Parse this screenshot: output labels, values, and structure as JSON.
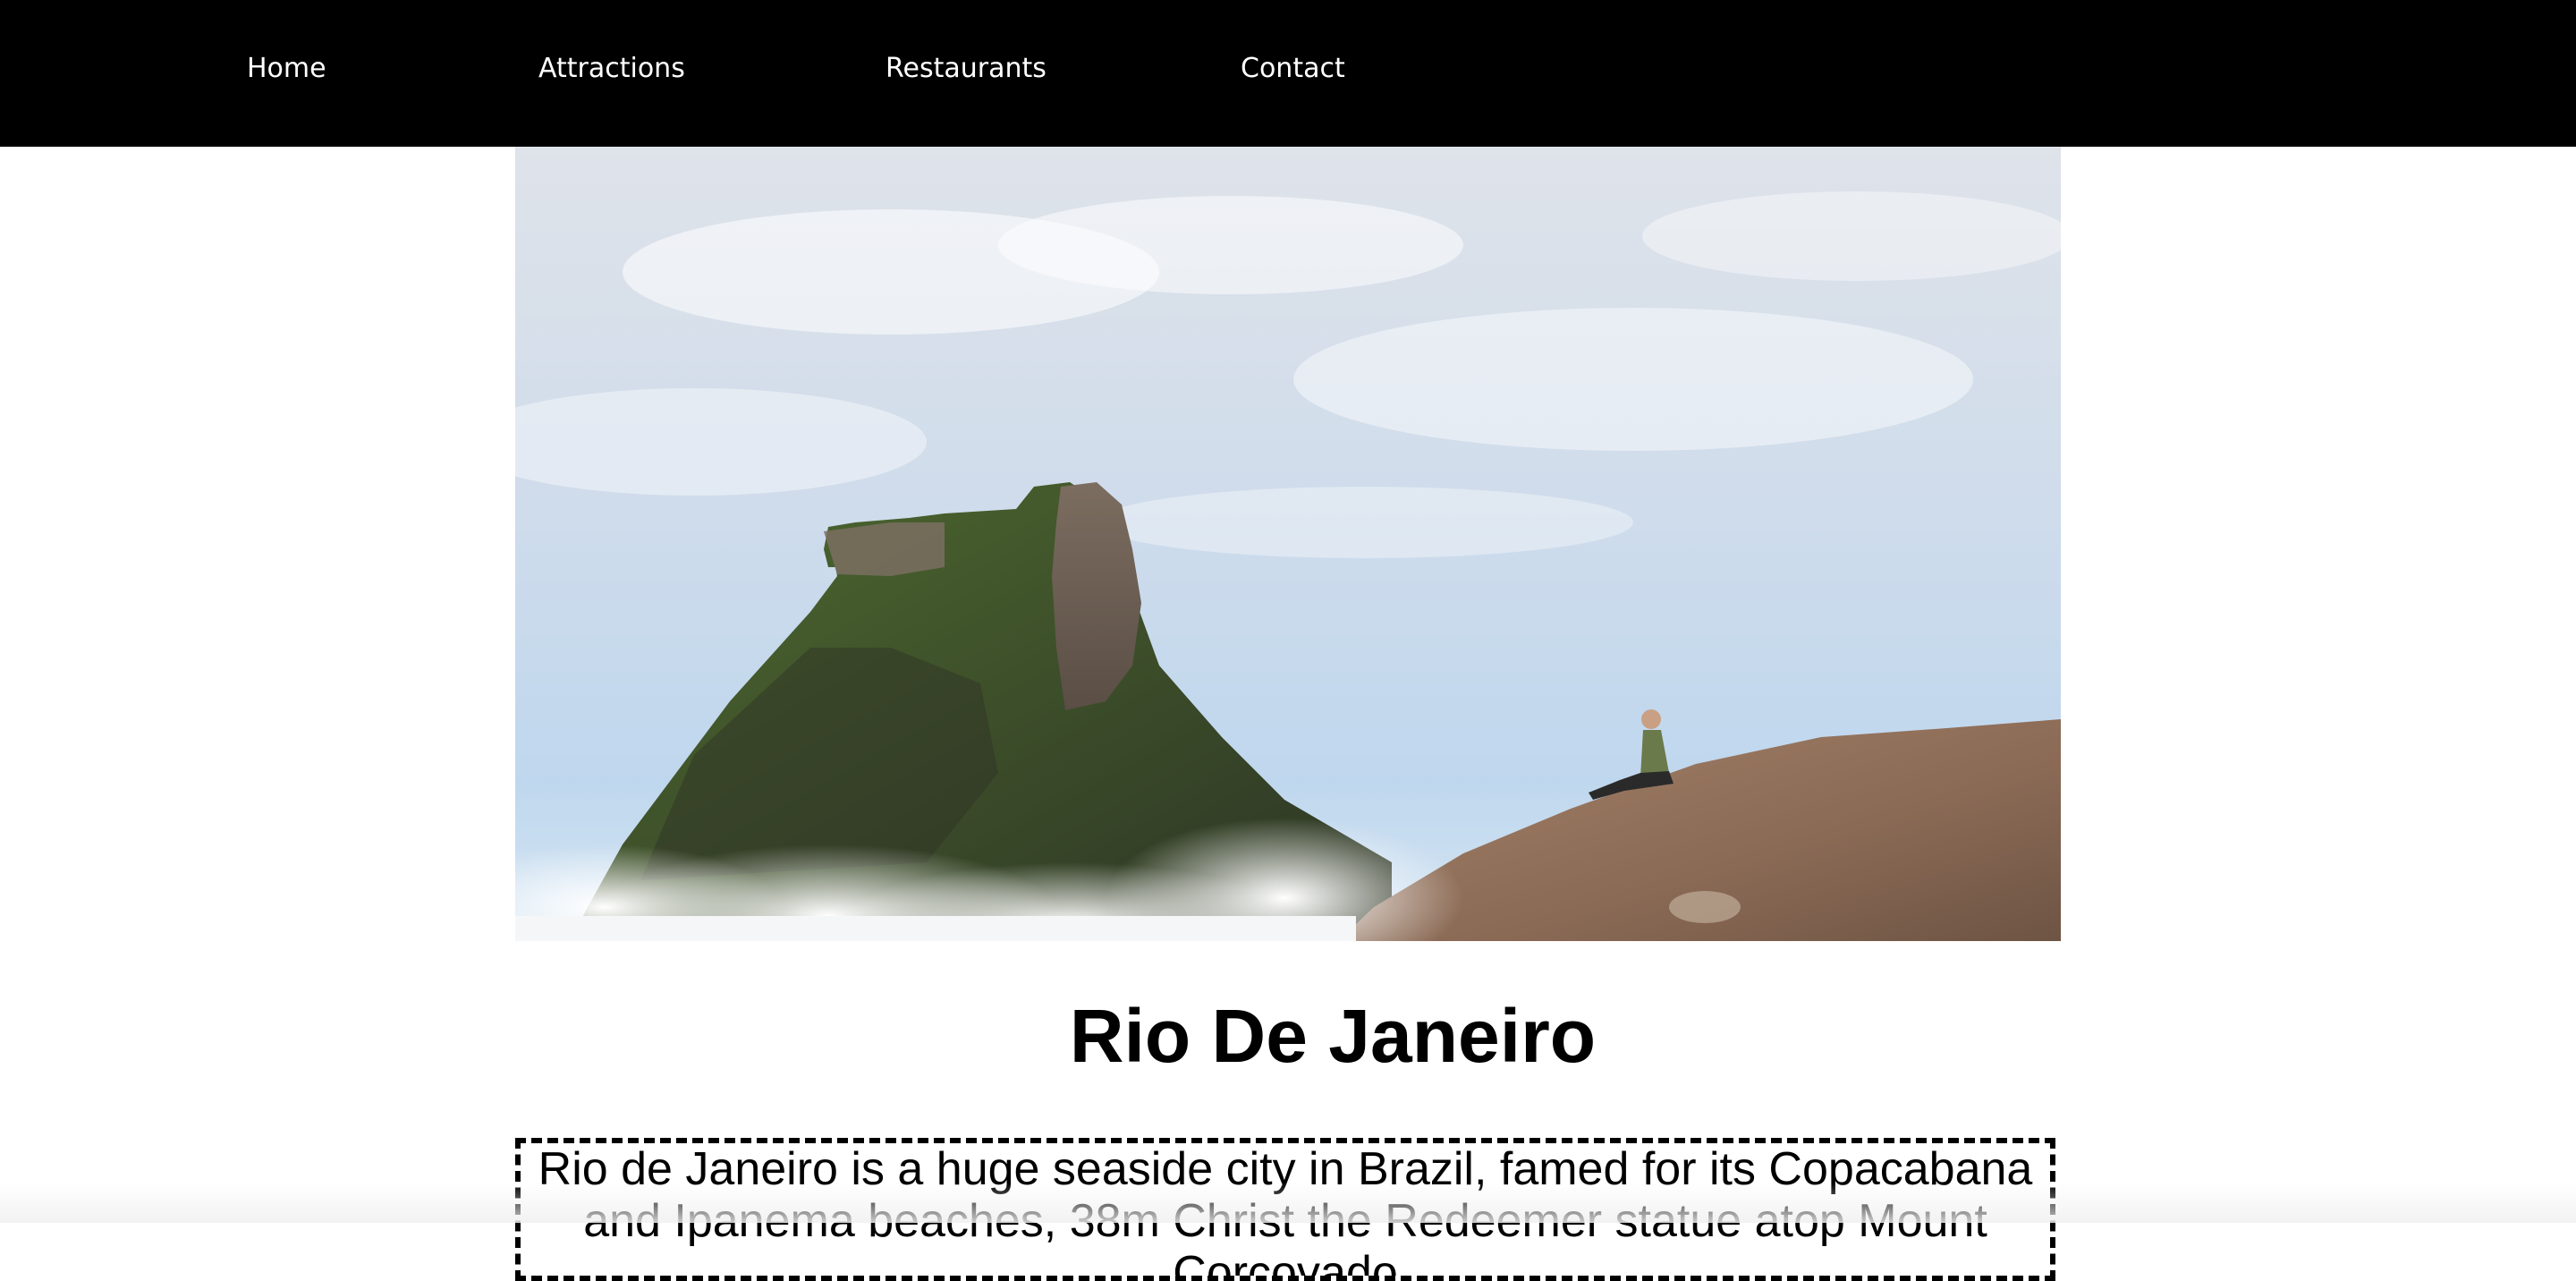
{
  "nav": {
    "items": [
      {
        "label": "Home"
      },
      {
        "label": "Attractions"
      },
      {
        "label": "Restaurants"
      },
      {
        "label": "Contact"
      }
    ]
  },
  "hero": {
    "alt": "Pedra da Gávea mountain above clouds with a person sitting on a rock"
  },
  "main": {
    "title": "Rio De Janeiro",
    "description": "Rio de Janeiro is a huge seaside city in Brazil, famed for its Copacabana and Ipanema beaches, 38m Christ the Redeemer statue atop Mount Corcovado"
  },
  "colors": {
    "nav_background": "#000000",
    "nav_text": "#ffffff",
    "page_background": "#ffffff"
  }
}
